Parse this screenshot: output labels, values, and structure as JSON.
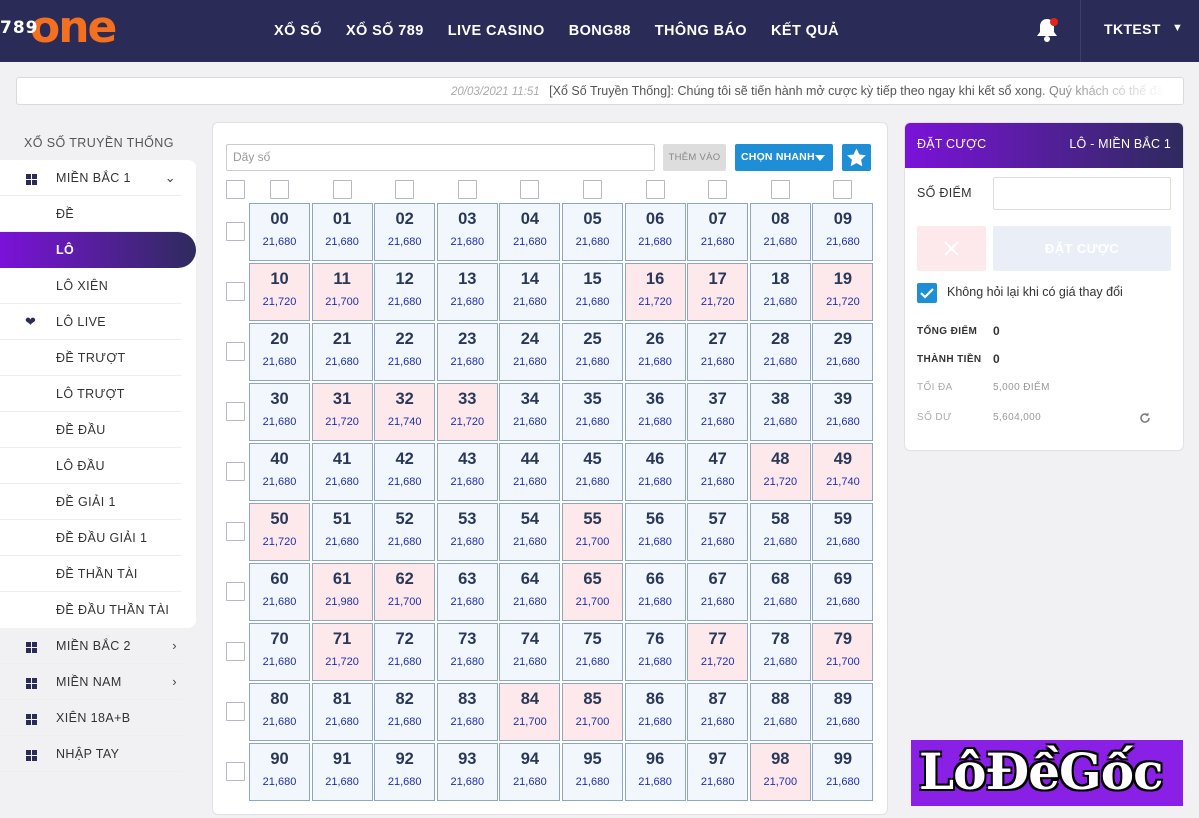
{
  "header": {
    "logo_number": "789",
    "logo_word": "one",
    "nav": [
      "XỔ SỐ",
      "XỔ SỐ 789",
      "LIVE CASINO",
      "BONG88",
      "THÔNG BÁO",
      "KẾT QUẢ"
    ],
    "user": "TKTEST",
    "icons": {
      "bell": "bell-icon",
      "user_caret": "chevron-down-icon"
    },
    "colors": {
      "topbar": "#2a2b56",
      "logo_accent": "#f37021",
      "notification_dot": "#e3241b"
    }
  },
  "ticker": {
    "date": "20/03/2021 11:51",
    "message": "[Xổ Số Truyền Thống]: Chúng tôi sẽ tiến hành mở cược kỳ tiếp theo ngay khi kết sổ xong. Quý khách có thể đặ"
  },
  "sidebar": {
    "title": "XỔ SỐ TRUYỀN THỐNG",
    "group": "MIỀN BẮC 1",
    "items": [
      "ĐỀ",
      "LÔ",
      "LÔ XIÊN",
      "LÔ LIVE",
      "ĐỀ TRƯỢT",
      "LÔ TRƯỢT",
      "ĐỀ ĐẦU",
      "LÔ ĐẦU",
      "ĐỀ GIẢI 1",
      "ĐỀ ĐẦU GIẢI 1",
      "ĐỀ THẦN TÀI",
      "ĐỀ ĐẦU THẦN TÀI"
    ],
    "active_item": "LÔ",
    "other_groups": [
      "MIỀN BẮC 2",
      "MIỀN NAM",
      "XIÊN 18A+B",
      "NHẬP TAY"
    ],
    "colors": {
      "active_gradient_start": "#7b12d9",
      "active_gradient_end": "#2e2b5d"
    }
  },
  "board": {
    "input_placeholder": "Dãy số",
    "add_label": "THÊM VÀO",
    "quick_pick_label": "CHỌN NHANH",
    "icons": {
      "quick_pick": "caret-down-icon",
      "favorite": "star-icon"
    },
    "numbers": [
      {
        "n": "00",
        "p": "21,680",
        "hot": false
      },
      {
        "n": "01",
        "p": "21,680",
        "hot": false
      },
      {
        "n": "02",
        "p": "21,680",
        "hot": false
      },
      {
        "n": "03",
        "p": "21,680",
        "hot": false
      },
      {
        "n": "04",
        "p": "21,680",
        "hot": false
      },
      {
        "n": "05",
        "p": "21,680",
        "hot": false
      },
      {
        "n": "06",
        "p": "21,680",
        "hot": false
      },
      {
        "n": "07",
        "p": "21,680",
        "hot": false
      },
      {
        "n": "08",
        "p": "21,680",
        "hot": false
      },
      {
        "n": "09",
        "p": "21,680",
        "hot": false
      },
      {
        "n": "10",
        "p": "21,720",
        "hot": true
      },
      {
        "n": "11",
        "p": "21,700",
        "hot": true
      },
      {
        "n": "12",
        "p": "21,680",
        "hot": false
      },
      {
        "n": "13",
        "p": "21,680",
        "hot": false
      },
      {
        "n": "14",
        "p": "21,680",
        "hot": false
      },
      {
        "n": "15",
        "p": "21,680",
        "hot": false
      },
      {
        "n": "16",
        "p": "21,720",
        "hot": true
      },
      {
        "n": "17",
        "p": "21,720",
        "hot": true
      },
      {
        "n": "18",
        "p": "21,680",
        "hot": false
      },
      {
        "n": "19",
        "p": "21,720",
        "hot": true
      },
      {
        "n": "20",
        "p": "21,680",
        "hot": false
      },
      {
        "n": "21",
        "p": "21,680",
        "hot": false
      },
      {
        "n": "22",
        "p": "21,680",
        "hot": false
      },
      {
        "n": "23",
        "p": "21,680",
        "hot": false
      },
      {
        "n": "24",
        "p": "21,680",
        "hot": false
      },
      {
        "n": "25",
        "p": "21,680",
        "hot": false
      },
      {
        "n": "26",
        "p": "21,680",
        "hot": false
      },
      {
        "n": "27",
        "p": "21,680",
        "hot": false
      },
      {
        "n": "28",
        "p": "21,680",
        "hot": false
      },
      {
        "n": "29",
        "p": "21,680",
        "hot": false
      },
      {
        "n": "30",
        "p": "21,680",
        "hot": false
      },
      {
        "n": "31",
        "p": "21,720",
        "hot": true
      },
      {
        "n": "32",
        "p": "21,740",
        "hot": true
      },
      {
        "n": "33",
        "p": "21,720",
        "hot": true
      },
      {
        "n": "34",
        "p": "21,680",
        "hot": false
      },
      {
        "n": "35",
        "p": "21,680",
        "hot": false
      },
      {
        "n": "36",
        "p": "21,680",
        "hot": false
      },
      {
        "n": "37",
        "p": "21,680",
        "hot": false
      },
      {
        "n": "38",
        "p": "21,680",
        "hot": false
      },
      {
        "n": "39",
        "p": "21,680",
        "hot": false
      },
      {
        "n": "40",
        "p": "21,680",
        "hot": false
      },
      {
        "n": "41",
        "p": "21,680",
        "hot": false
      },
      {
        "n": "42",
        "p": "21,680",
        "hot": false
      },
      {
        "n": "43",
        "p": "21,680",
        "hot": false
      },
      {
        "n": "44",
        "p": "21,680",
        "hot": false
      },
      {
        "n": "45",
        "p": "21,680",
        "hot": false
      },
      {
        "n": "46",
        "p": "21,680",
        "hot": false
      },
      {
        "n": "47",
        "p": "21,680",
        "hot": false
      },
      {
        "n": "48",
        "p": "21,720",
        "hot": true
      },
      {
        "n": "49",
        "p": "21,740",
        "hot": true
      },
      {
        "n": "50",
        "p": "21,720",
        "hot": true
      },
      {
        "n": "51",
        "p": "21,680",
        "hot": false
      },
      {
        "n": "52",
        "p": "21,680",
        "hot": false
      },
      {
        "n": "53",
        "p": "21,680",
        "hot": false
      },
      {
        "n": "54",
        "p": "21,680",
        "hot": false
      },
      {
        "n": "55",
        "p": "21,700",
        "hot": true
      },
      {
        "n": "56",
        "p": "21,680",
        "hot": false
      },
      {
        "n": "57",
        "p": "21,680",
        "hot": false
      },
      {
        "n": "58",
        "p": "21,680",
        "hot": false
      },
      {
        "n": "59",
        "p": "21,680",
        "hot": false
      },
      {
        "n": "60",
        "p": "21,680",
        "hot": false
      },
      {
        "n": "61",
        "p": "21,980",
        "hot": true
      },
      {
        "n": "62",
        "p": "21,700",
        "hot": true
      },
      {
        "n": "63",
        "p": "21,680",
        "hot": false
      },
      {
        "n": "64",
        "p": "21,680",
        "hot": false
      },
      {
        "n": "65",
        "p": "21,700",
        "hot": true
      },
      {
        "n": "66",
        "p": "21,680",
        "hot": false
      },
      {
        "n": "67",
        "p": "21,680",
        "hot": false
      },
      {
        "n": "68",
        "p": "21,680",
        "hot": false
      },
      {
        "n": "69",
        "p": "21,680",
        "hot": false
      },
      {
        "n": "70",
        "p": "21,680",
        "hot": false
      },
      {
        "n": "71",
        "p": "21,720",
        "hot": true
      },
      {
        "n": "72",
        "p": "21,680",
        "hot": false
      },
      {
        "n": "73",
        "p": "21,680",
        "hot": false
      },
      {
        "n": "74",
        "p": "21,680",
        "hot": false
      },
      {
        "n": "75",
        "p": "21,680",
        "hot": false
      },
      {
        "n": "76",
        "p": "21,680",
        "hot": false
      },
      {
        "n": "77",
        "p": "21,720",
        "hot": true
      },
      {
        "n": "78",
        "p": "21,680",
        "hot": false
      },
      {
        "n": "79",
        "p": "21,700",
        "hot": true
      },
      {
        "n": "80",
        "p": "21,680",
        "hot": false
      },
      {
        "n": "81",
        "p": "21,680",
        "hot": false
      },
      {
        "n": "82",
        "p": "21,680",
        "hot": false
      },
      {
        "n": "83",
        "p": "21,680",
        "hot": false
      },
      {
        "n": "84",
        "p": "21,700",
        "hot": true
      },
      {
        "n": "85",
        "p": "21,700",
        "hot": true
      },
      {
        "n": "86",
        "p": "21,680",
        "hot": false
      },
      {
        "n": "87",
        "p": "21,680",
        "hot": false
      },
      {
        "n": "88",
        "p": "21,680",
        "hot": false
      },
      {
        "n": "89",
        "p": "21,680",
        "hot": false
      },
      {
        "n": "90",
        "p": "21,680",
        "hot": false
      },
      {
        "n": "91",
        "p": "21,680",
        "hot": false
      },
      {
        "n": "92",
        "p": "21,680",
        "hot": false
      },
      {
        "n": "93",
        "p": "21,680",
        "hot": false
      },
      {
        "n": "94",
        "p": "21,680",
        "hot": false
      },
      {
        "n": "95",
        "p": "21,680",
        "hot": false
      },
      {
        "n": "96",
        "p": "21,680",
        "hot": false
      },
      {
        "n": "97",
        "p": "21,680",
        "hot": false
      },
      {
        "n": "98",
        "p": "21,700",
        "hot": true
      },
      {
        "n": "99",
        "p": "21,680",
        "hot": false
      }
    ],
    "colors": {
      "cell": "#f2f7fd",
      "cell_hot": "#fde8ec",
      "price_text": "#1e2fb0",
      "button": "#1e8ed6"
    }
  },
  "bet_panel": {
    "title": "ĐẶT CƯỢC",
    "game": "LÔ - MIỀN BẮC 1",
    "points_label": "SỐ ĐIỂM",
    "points_value": "",
    "clear_icon": "close-icon",
    "submit_label": "ĐẶT CƯỢC",
    "no_ask_checked": true,
    "no_ask_label": "Không hỏi lại khi có giá thay đổi",
    "total_points_label": "TỔNG ĐIỂM",
    "total_points": "0",
    "amount_label": "THÀNH TIỀN",
    "amount": "0",
    "max_label": "TỐI ĐA",
    "max_value": "5,000 ĐIỂM",
    "balance_label": "SỐ DƯ",
    "balance": "5,604,000",
    "refresh_icon": "refresh-icon"
  },
  "watermark": "LôĐềGốc"
}
